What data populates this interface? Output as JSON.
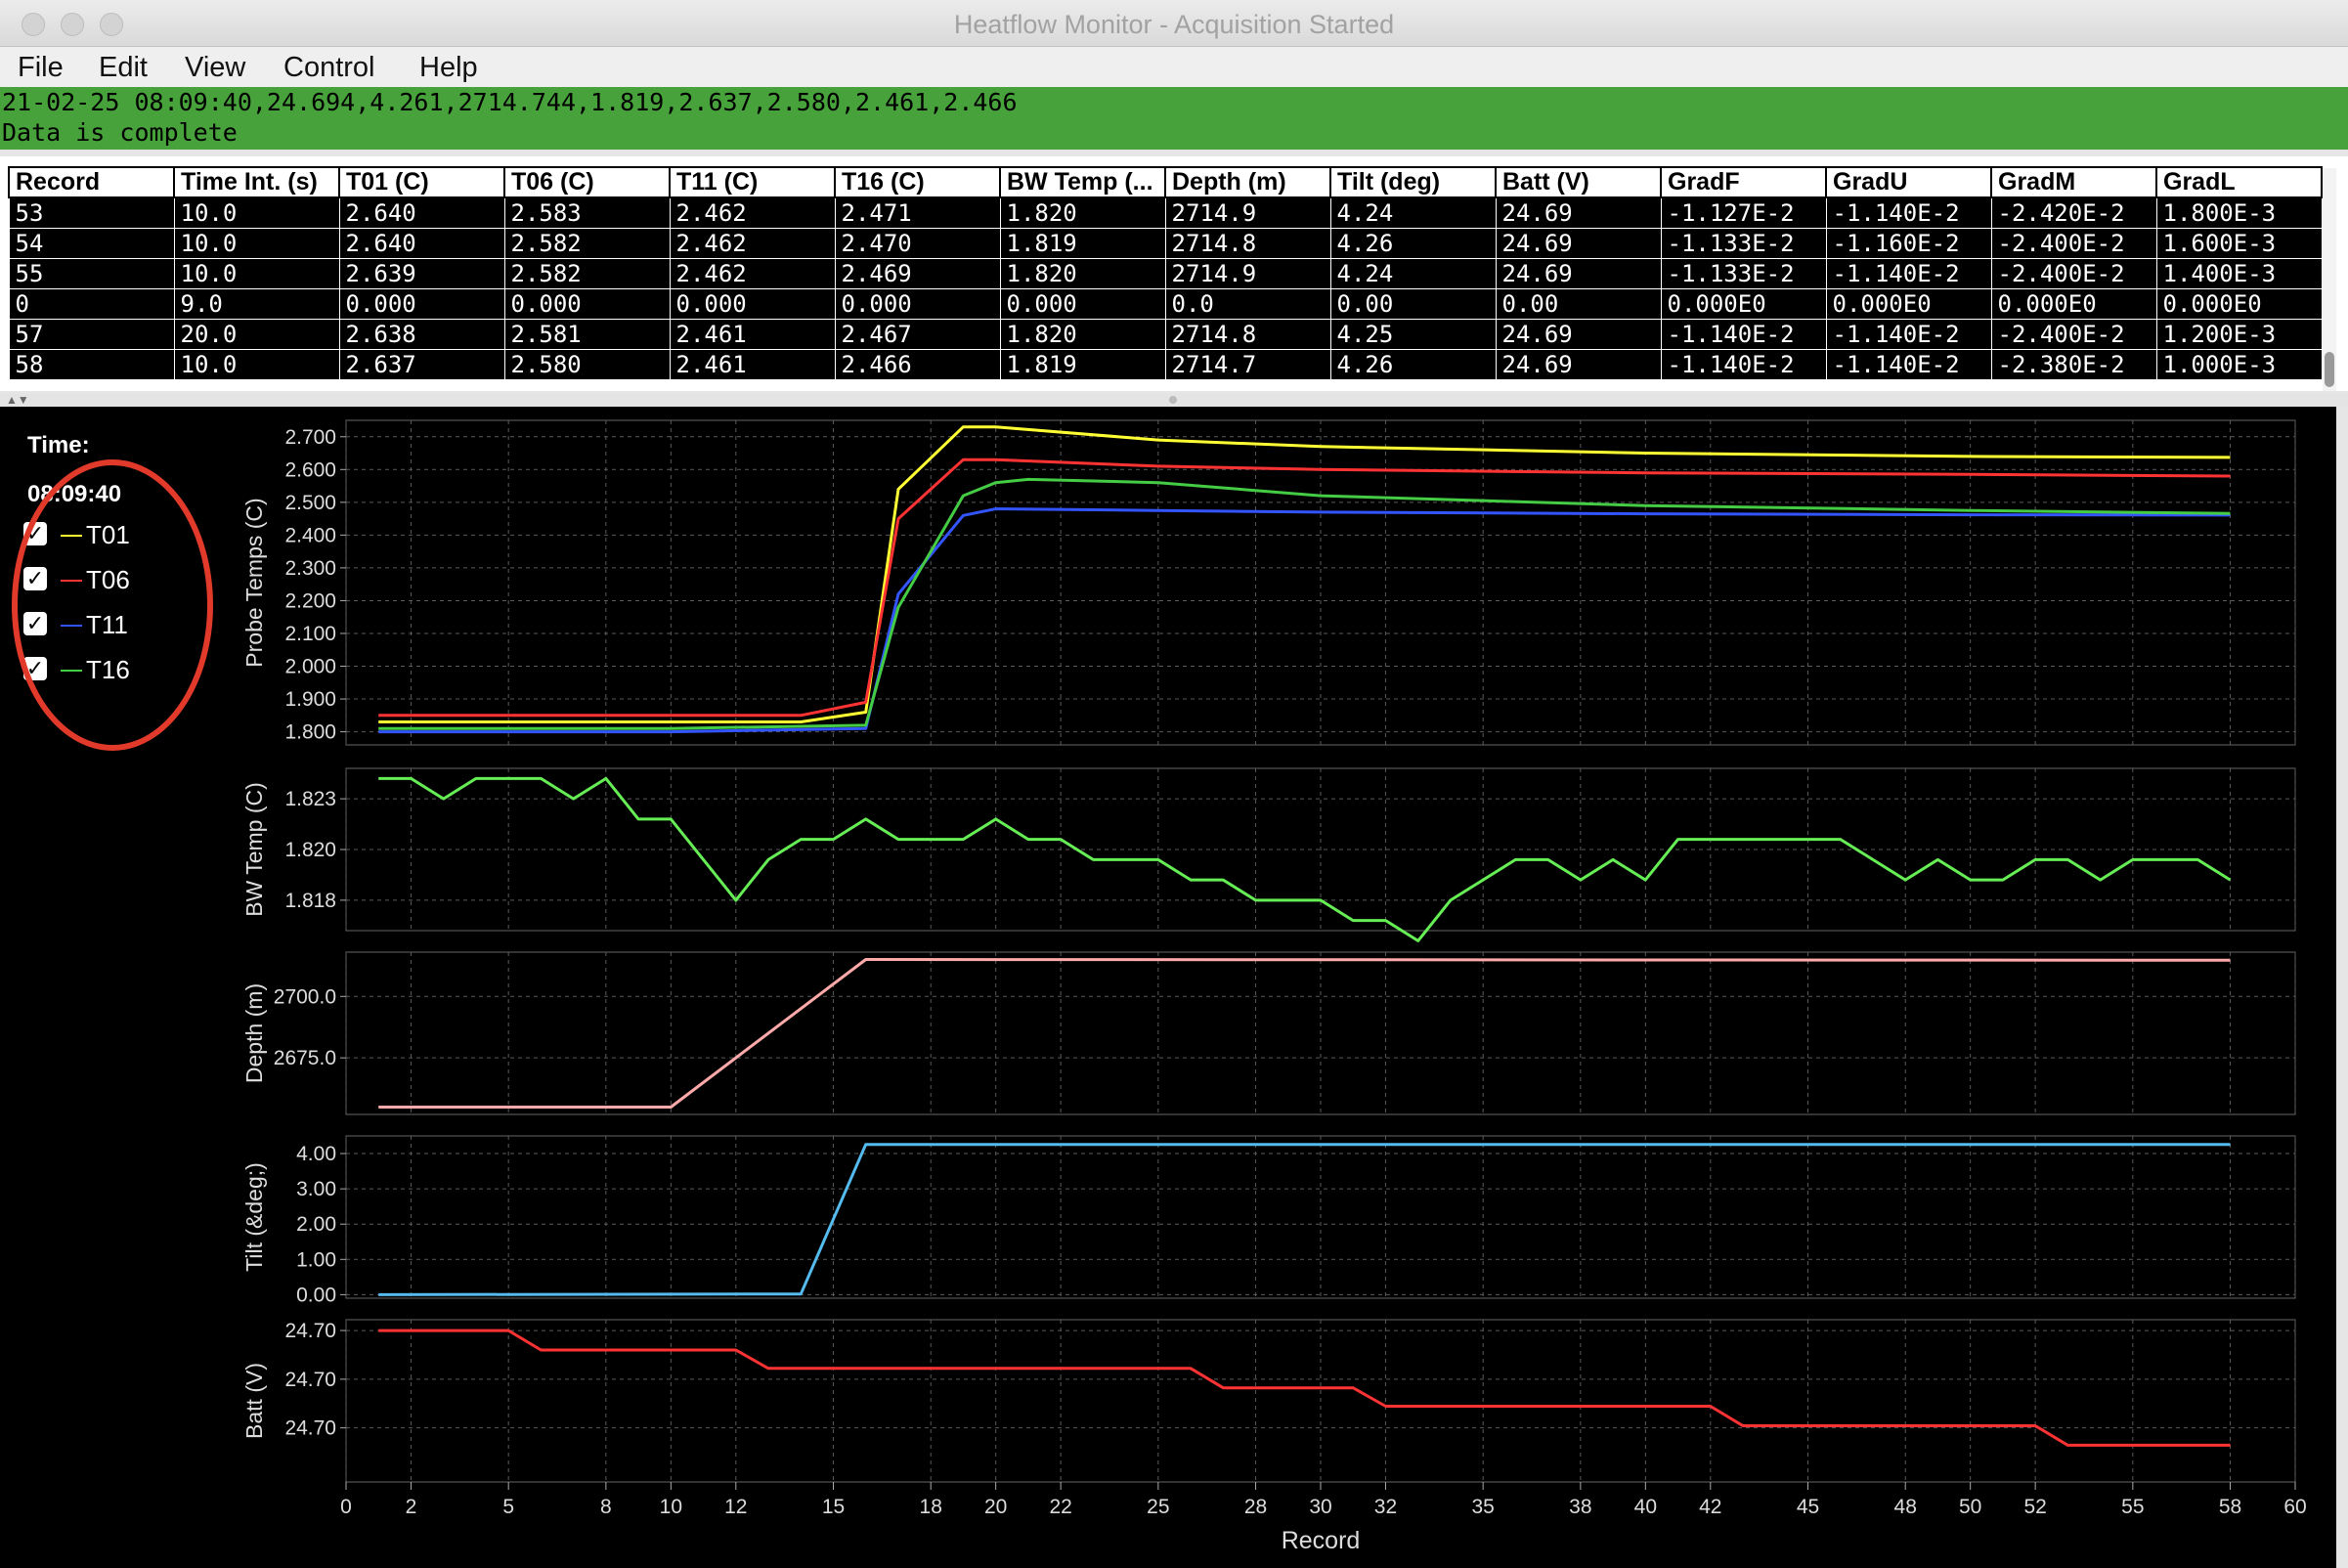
{
  "window": {
    "title": "Heatflow Monitor - Acquisition Started"
  },
  "menu": [
    "File",
    "Edit",
    "View",
    "Control",
    "Help"
  ],
  "status": {
    "line1": "21-02-25 08:09:40,24.694,4.261,2714.744,1.819,2.637,2.580,2.461,2.466",
    "line2": "Data is complete",
    "color": "#47a23b"
  },
  "table": {
    "columns": [
      "Record",
      "Time Int. (s)",
      "T01 (C)",
      "T06 (C)",
      "T11 (C)",
      "T16 (C)",
      "BW Temp (...",
      "Depth (m)",
      "Tilt (deg)",
      "Batt (V)",
      "GradF",
      "GradU",
      "GradM",
      "GradL"
    ],
    "rows": [
      [
        "53",
        "10.0",
        "2.640",
        "2.583",
        "2.462",
        "2.471",
        "1.820",
        "2714.9",
        "4.24",
        "24.69",
        "-1.127E-2",
        "-1.140E-2",
        "-2.420E-2",
        "1.800E-3"
      ],
      [
        "54",
        "10.0",
        "2.640",
        "2.582",
        "2.462",
        "2.470",
        "1.819",
        "2714.8",
        "4.26",
        "24.69",
        "-1.133E-2",
        "-1.160E-2",
        "-2.400E-2",
        "1.600E-3"
      ],
      [
        "55",
        "10.0",
        "2.639",
        "2.582",
        "2.462",
        "2.469",
        "1.820",
        "2714.9",
        "4.24",
        "24.69",
        "-1.133E-2",
        "-1.140E-2",
        "-2.400E-2",
        "1.400E-3"
      ],
      [
        "0",
        "9.0",
        "0.000",
        "0.000",
        "0.000",
        "0.000",
        "0.000",
        "0.0",
        "0.00",
        "0.00",
        "0.000E0",
        "0.000E0",
        "0.000E0",
        "0.000E0"
      ],
      [
        "57",
        "20.0",
        "2.638",
        "2.581",
        "2.461",
        "2.467",
        "1.820",
        "2714.8",
        "4.25",
        "24.69",
        "-1.140E-2",
        "-1.140E-2",
        "-2.400E-2",
        "1.200E-3"
      ],
      [
        "58",
        "10.0",
        "2.637",
        "2.580",
        "2.461",
        "2.466",
        "1.819",
        "2714.7",
        "4.26",
        "24.69",
        "-1.140E-2",
        "-1.140E-2",
        "-2.380E-2",
        "1.000E-3"
      ]
    ]
  },
  "legend": {
    "time_label": "Time:",
    "time_value": "08:09:40",
    "items": [
      {
        "label": "T01",
        "color": "#ffff33",
        "checked": true
      },
      {
        "label": "T06",
        "color": "#ff3333",
        "checked": true
      },
      {
        "label": "T11",
        "color": "#3355ff",
        "checked": true
      },
      {
        "label": "T16",
        "color": "#44cc44",
        "checked": true
      }
    ],
    "highlight_color": "#e23a2a"
  },
  "chart_data": [
    {
      "type": "line",
      "ylabel": "Probe Temps (C)",
      "xlabel": "",
      "ylim": [
        1.76,
        2.75
      ],
      "yticks": [
        "1.800",
        "1.900",
        "2.000",
        "2.100",
        "2.200",
        "2.300",
        "2.400",
        "2.500",
        "2.600",
        "2.700"
      ],
      "grid": true,
      "series": [
        {
          "name": "T01",
          "color": "#ffff33",
          "x": [
            1,
            10,
            14,
            16,
            17,
            19,
            20,
            25,
            30,
            40,
            50,
            58
          ],
          "y": [
            1.83,
            1.83,
            1.83,
            1.86,
            2.54,
            2.73,
            2.73,
            2.69,
            2.67,
            2.65,
            2.64,
            2.637
          ]
        },
        {
          "name": "T06",
          "color": "#ff3333",
          "x": [
            1,
            10,
            14,
            16,
            17,
            19,
            20,
            25,
            30,
            40,
            50,
            58
          ],
          "y": [
            1.85,
            1.85,
            1.85,
            1.89,
            2.45,
            2.63,
            2.63,
            2.61,
            2.6,
            2.59,
            2.585,
            2.58
          ]
        },
        {
          "name": "T11",
          "color": "#3355ff",
          "x": [
            1,
            10,
            16,
            17,
            19,
            20,
            25,
            30,
            40,
            50,
            58
          ],
          "y": [
            1.8,
            1.8,
            1.81,
            2.22,
            2.46,
            2.48,
            2.475,
            2.47,
            2.465,
            2.462,
            2.461
          ]
        },
        {
          "name": "T16",
          "color": "#44cc44",
          "x": [
            1,
            10,
            16,
            17,
            19,
            20,
            21,
            25,
            30,
            40,
            50,
            58
          ],
          "y": [
            1.81,
            1.81,
            1.82,
            2.18,
            2.52,
            2.56,
            2.57,
            2.56,
            2.52,
            2.49,
            2.475,
            2.466
          ]
        }
      ]
    },
    {
      "type": "line",
      "ylabel": "BW Temp (C)",
      "xlabel": "",
      "ylim": [
        1.8165,
        1.8245
      ],
      "yticks": [
        "1.818",
        "1.820",
        "1.823"
      ],
      "ytick_values": [
        1.818,
        1.8205,
        1.823
      ],
      "grid": true,
      "series": [
        {
          "name": "",
          "color": "#66ee55",
          "x": [
            1,
            2,
            3,
            4,
            5,
            6,
            7,
            8,
            9,
            10,
            11,
            12,
            13,
            14,
            15,
            16,
            17,
            18,
            19,
            20,
            21,
            22,
            23,
            24,
            25,
            26,
            27,
            28,
            29,
            30,
            31,
            32,
            33,
            34,
            35,
            36,
            37,
            38,
            39,
            40,
            41,
            42,
            43,
            44,
            45,
            46,
            47,
            48,
            49,
            50,
            51,
            52,
            53,
            54,
            55,
            56,
            57,
            58
          ],
          "y": [
            1.824,
            1.824,
            1.823,
            1.824,
            1.824,
            1.824,
            1.823,
            1.824,
            1.822,
            1.822,
            1.82,
            1.818,
            1.82,
            1.821,
            1.821,
            1.822,
            1.821,
            1.821,
            1.821,
            1.822,
            1.821,
            1.821,
            1.82,
            1.82,
            1.82,
            1.819,
            1.819,
            1.818,
            1.818,
            1.818,
            1.817,
            1.817,
            1.816,
            1.818,
            1.819,
            1.82,
            1.82,
            1.819,
            1.82,
            1.819,
            1.821,
            1.821,
            1.821,
            1.821,
            1.821,
            1.821,
            1.82,
            1.819,
            1.82,
            1.819,
            1.819,
            1.82,
            1.82,
            1.819,
            1.82,
            1.82,
            1.82,
            1.819
          ]
        }
      ]
    },
    {
      "type": "line",
      "ylabel": "Depth (m)",
      "xlabel": "",
      "ylim": [
        2652,
        2718
      ],
      "yticks": [
        "2675.0",
        "2700.0"
      ],
      "ytick_values": [
        2675,
        2700
      ],
      "grid": true,
      "series": [
        {
          "name": "",
          "color": "#ffaaaa",
          "x": [
            1,
            10,
            16,
            58
          ],
          "y": [
            2655,
            2655,
            2715,
            2714.7
          ]
        }
      ]
    },
    {
      "type": "line",
      "ylabel": "Tilt (&deg;)",
      "xlabel": "",
      "ylim": [
        -0.1,
        4.5
      ],
      "yticks": [
        "0.00",
        "1.00",
        "2.00",
        "3.00",
        "4.00"
      ],
      "ytick_values": [
        0,
        1,
        2,
        3,
        4
      ],
      "grid": true,
      "series": [
        {
          "name": "",
          "color": "#55bbee",
          "x": [
            1,
            13,
            14,
            16,
            58
          ],
          "y": [
            0,
            0.02,
            0.02,
            4.26,
            4.26
          ]
        }
      ]
    },
    {
      "type": "line",
      "ylabel": "Batt (V)",
      "xlabel": "Record",
      "xlim": [
        0,
        60
      ],
      "xticks": [
        0,
        2,
        5,
        8,
        10,
        12,
        15,
        18,
        20,
        22,
        25,
        28,
        30,
        32,
        35,
        38,
        40,
        42,
        45,
        48,
        50,
        52,
        55,
        58,
        60
      ],
      "ylim": [
        24.6,
        24.75
      ],
      "yticks": [
        "24.70",
        "24.70",
        "24.70"
      ],
      "ytick_values": [
        24.74,
        24.695,
        24.65
      ],
      "grid": true,
      "series": [
        {
          "name": "",
          "color": "#ff3333",
          "x": [
            1,
            5,
            6,
            12,
            13,
            26,
            27,
            31,
            32,
            42,
            43,
            52,
            53,
            58
          ],
          "y": [
            24.74,
            24.74,
            24.722,
            24.722,
            24.705,
            24.705,
            24.687,
            24.687,
            24.67,
            24.67,
            24.652,
            24.652,
            24.634,
            24.634
          ]
        }
      ]
    }
  ]
}
